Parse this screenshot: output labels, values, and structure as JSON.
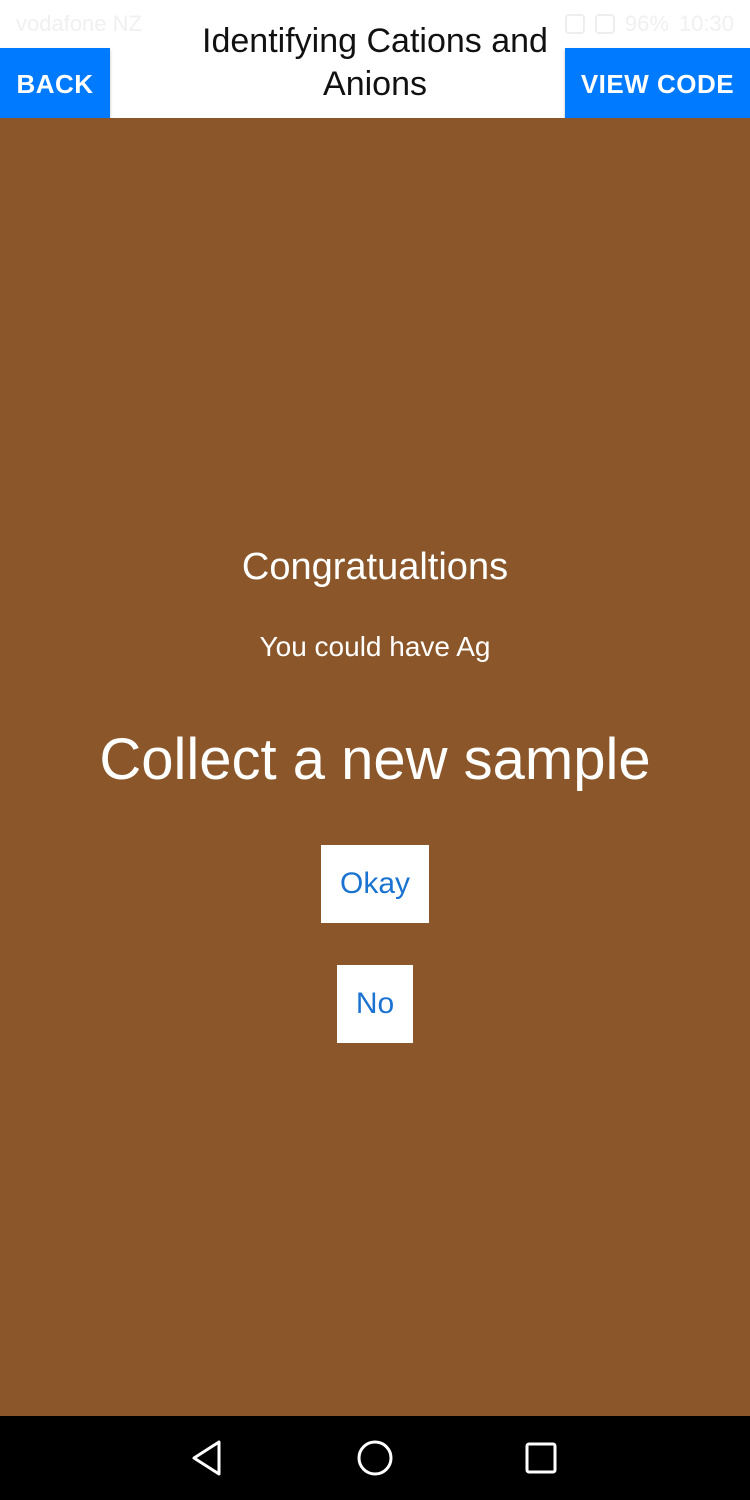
{
  "status_bar": {
    "carrier": "vodafone NZ",
    "battery": "96%",
    "time": "10:30"
  },
  "header": {
    "back_label": "BACK",
    "title": "Identifying Cations and Anions",
    "view_code_label": "VIEW CODE"
  },
  "main": {
    "congrats": "Congratualtions",
    "result": "You could have Ag",
    "prompt": "Collect a new sample",
    "okay_label": "Okay",
    "no_label": "No"
  },
  "colors": {
    "background": "#8B572A",
    "accent": "#007AFF"
  },
  "icons": {
    "nav_back": "triangle-back-icon",
    "nav_home": "circle-home-icon",
    "nav_recent": "square-recent-icon"
  }
}
